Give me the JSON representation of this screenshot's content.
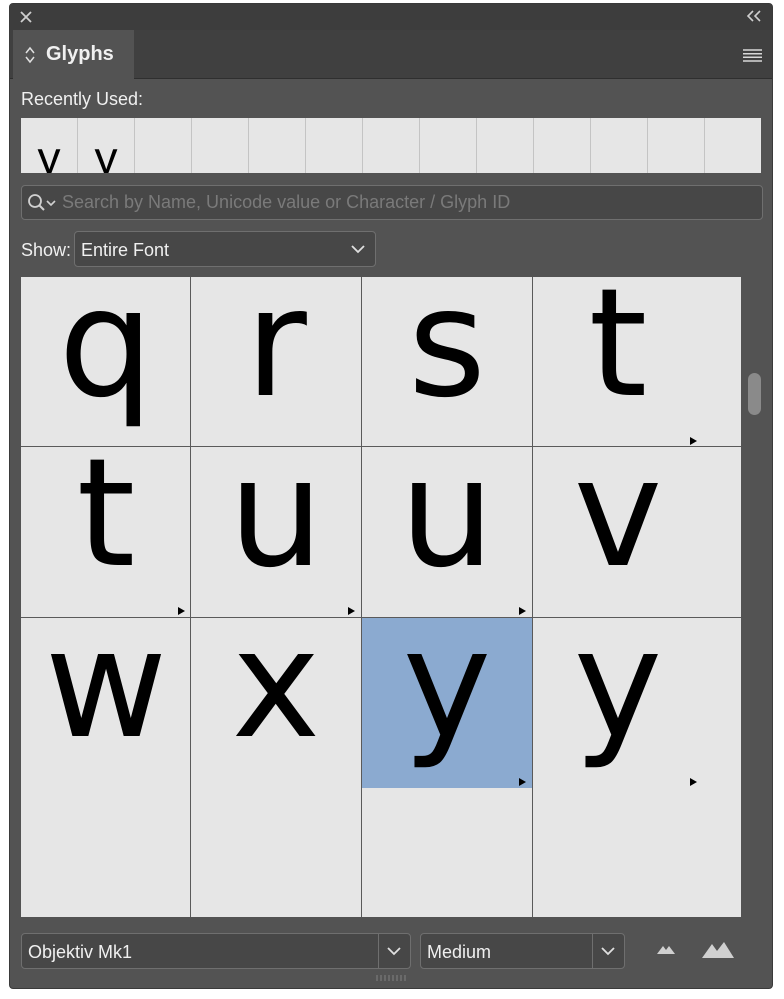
{
  "panel": {
    "tab_title": "Glyphs",
    "icons": {
      "close": "close-icon",
      "collapse": "double-chevron-left-icon",
      "tab_arrows": "up-down-arrows-icon",
      "menu": "hamburger-menu-icon"
    }
  },
  "recent": {
    "label": "Recently Used:",
    "glyphs": [
      "y",
      "y",
      "",
      "",
      "",
      "",
      "",
      "",
      "",
      "",
      "",
      "",
      ""
    ]
  },
  "search": {
    "placeholder": "Search by Name, Unicode value or Character / Glyph ID",
    "value": ""
  },
  "show": {
    "label": "Show:",
    "value": "Entire Font"
  },
  "grid": {
    "glyphs": [
      {
        "char": "q",
        "has_alternates": false,
        "selected": false
      },
      {
        "char": "r",
        "has_alternates": false,
        "selected": false
      },
      {
        "char": "s",
        "has_alternates": false,
        "selected": false
      },
      {
        "char": "t",
        "has_alternates": true,
        "selected": false
      },
      {
        "char": "t",
        "has_alternates": true,
        "selected": false
      },
      {
        "char": "u",
        "has_alternates": true,
        "selected": false
      },
      {
        "char": "u",
        "has_alternates": true,
        "selected": false
      },
      {
        "char": "v",
        "has_alternates": false,
        "selected": false
      },
      {
        "char": "w",
        "has_alternates": false,
        "selected": false
      },
      {
        "char": "x",
        "has_alternates": false,
        "selected": false
      },
      {
        "char": "y",
        "has_alternates": true,
        "selected": true
      },
      {
        "char": "y",
        "has_alternates": true,
        "selected": false
      }
    ],
    "selection_color": "#8baad0"
  },
  "bottom": {
    "font_family": "Objektiv Mk1",
    "font_style": "Medium",
    "icons": {
      "zoom_out": "small-mountains-icon",
      "zoom_in": "large-mountains-icon"
    }
  },
  "colors": {
    "panel_bg": "#535353",
    "cell_bg": "#e6e6e6",
    "text": "#f0f0f0"
  }
}
